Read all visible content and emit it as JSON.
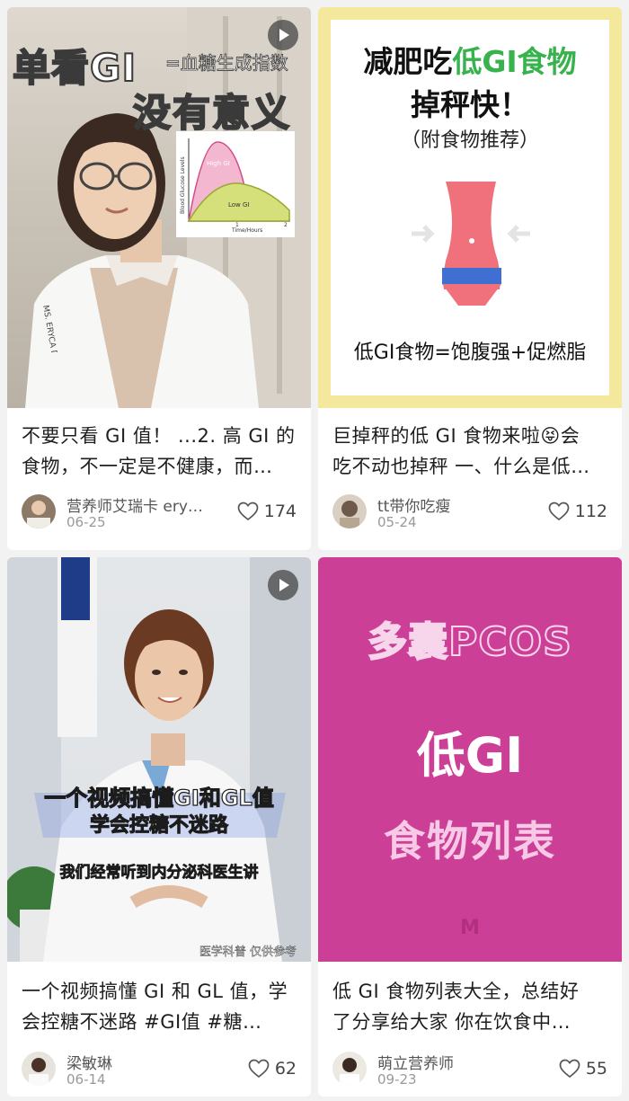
{
  "feed": {
    "cards": [
      {
        "cover": {
          "line1": "单看GI",
          "line2": "=血糖生成指数",
          "line3": "没有意义",
          "chart_labels": {
            "high": "High GI",
            "low": "Low GI",
            "ylabel": "Blood Glucose Levels",
            "xlabel": "Time/Hours",
            "tick1": "1",
            "tick2": "2"
          },
          "coat_text": "MS. ERYCA DIETITIAN"
        },
        "caption": "不要只看 GI 值！ ...2. 高 GI 的食物，不一定是不健康，而…",
        "caption_line1": "不要只看 GI 值！ ...2. 高 GI 的",
        "caption_line2": "食物，不一定是不健康，而…",
        "author": "营养师艾瑞卡 ery…",
        "date": "06-25",
        "likes": "174",
        "is_video": true
      },
      {
        "cover": {
          "title_black": "减肥吃",
          "title_green": "低GI食物",
          "title_line2": "掉秤快！",
          "subtitle": "（附食物推荐）",
          "footer": "低GI食物=饱腹强+促燃脂"
        },
        "caption": "巨掉秤的低 GI 食物来啦😝会吃不动也掉秤 一、什么是低…",
        "caption_line1": "巨掉秤的低 GI 食物来啦😝会",
        "caption_line2": "吃不动也掉秤 一、什么是低…",
        "author": "tt带你吃瘦",
        "date": "05-24",
        "likes": "112",
        "is_video": false
      },
      {
        "cover": {
          "line1": "一个视频搞懂GI和GL值",
          "line2": "学会控糖不迷路",
          "line3": "我们经常听到内分泌科医生讲",
          "line4": "医学科普 仅供参考"
        },
        "caption": "一个视频搞懂 GI 和 GL 值，学会控糖不迷路 #GI值 #糖…",
        "caption_line1": "一个视频搞懂 GI 和 GL 值，学",
        "caption_line2": "会控糖不迷路 #GI值  #糖…",
        "author": "梁敏琳",
        "date": "06-14",
        "likes": "62",
        "is_video": true
      },
      {
        "cover": {
          "line1": "多囊PCOS",
          "line2": "低GI",
          "line3": "食物列表",
          "mark": "M"
        },
        "caption": "低 GI 食物列表大全，总结好了分享给大家 你在饮食中…",
        "caption_line1": "低 GI 食物列表大全，总结好",
        "caption_line2": "了分享给大家 你在饮食中…",
        "author": "萌立营养师",
        "date": "09-23",
        "likes": "55",
        "is_video": false
      }
    ]
  },
  "icons": {
    "like": "heart-outline-icon",
    "video": "play-icon"
  },
  "colors": {
    "background": "#f2f2f2",
    "card": "#ffffff",
    "gi_green": "#37b24d",
    "pcos_magenta": "#cc3f96",
    "poster_yellow": "#f3e89c"
  }
}
